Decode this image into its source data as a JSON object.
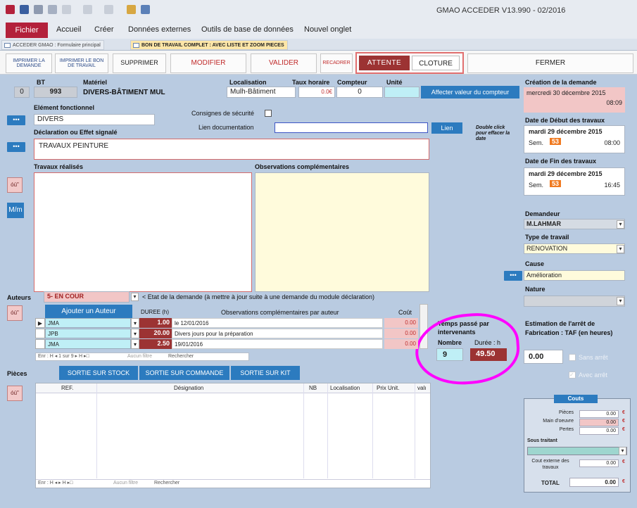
{
  "app": {
    "title": "GMAO ACCEDER V13.990 - 02/2016"
  },
  "ribbon": {
    "tabs": [
      "Fichier",
      "Accueil",
      "Créer",
      "Données externes",
      "Outils de base de données",
      "Nouvel onglet"
    ]
  },
  "doctabs": [
    "ACCEDER GMAO : Formulaire principal",
    "BON DE TRAVAIL COMPLET : AVEC LISTE  ET ZOOM PIECES"
  ],
  "toolbar": {
    "print_request": "IMPRIMER LA DEMANDE",
    "print_bt": "IMPRIMER LE BON DE TRAVAIL",
    "delete": "SUPPRIMER",
    "modify": "MODIFIER",
    "validate": "VALIDER",
    "recadrer": "RECADRER",
    "attente": "ATTENTE",
    "cloture": "CLOTURE",
    "close": "FERMER"
  },
  "header": {
    "labels": {
      "bt": "BT",
      "materiel": "Matériel",
      "localisation": "Localisation",
      "taux": "Taux horaire",
      "compteur": "Compteur",
      "unite": "Unité"
    },
    "zero": "0",
    "bt": "993",
    "materiel": "DIVERS-BÂTIMENT MUL",
    "localisation": "Mulh-Bâtiment",
    "taux": "0.0€",
    "compteur": "0",
    "affecter": "Affecter valeur du compteur"
  },
  "element": {
    "label": "Elément fonctionnel",
    "value": "DIVERS"
  },
  "consignes": {
    "label": "Consignes de sécurité"
  },
  "lien": {
    "label": "Lien documentation",
    "button": "Lien"
  },
  "declaration": {
    "label": "Déclaration ou Effet signalé",
    "value": "TRAVAUX PEINTURE"
  },
  "hint": "Double click pour effacer la date",
  "travaux": {
    "label": "Travaux réalisés"
  },
  "observations": {
    "label": "Observations complémentaires"
  },
  "sidebuttons": {
    "ou": "óù\"",
    "mm": "M/m"
  },
  "creation": {
    "label": "Création de la demande",
    "date": "mercredi 30 décembre 2015",
    "time": "08:09"
  },
  "debut": {
    "label": "Date de Début des travaux",
    "date": "mardi 29 décembre 2015",
    "sem_label": "Sem.",
    "sem": "53",
    "time": "08:00"
  },
  "fin": {
    "label": "Date de Fin des travaux",
    "date": "mardi 29 décembre 2015",
    "sem_label": "Sem.",
    "sem": "53",
    "time": "16:45"
  },
  "demandeur": {
    "label": "Demandeur",
    "value": "M.LAHMAR"
  },
  "type_travail": {
    "label": "Type de travail",
    "value": "RENOVATION"
  },
  "cause": {
    "label": "Cause",
    "value": "Amélioration"
  },
  "nature": {
    "label": "Nature",
    "value": ""
  },
  "estimation": {
    "label": "Estimation de l'arrêt de Fabrication : TAF (en heures)",
    "value": "0.00",
    "sans": "Sans arrêt",
    "avec": "Avec arrêt"
  },
  "auteurs": {
    "label": "Auteurs",
    "etat": "5- EN COUR",
    "etat_hint": "< Etat de la demande (à mettre à jour suite à une demande du module déclaration)",
    "add_button": "Ajouter un Auteur",
    "col_duree": "DUREE (h)",
    "col_obs": "Observations complémentaires par auteur",
    "col_cout": "Coût",
    "rows": [
      {
        "auteur": "JMA",
        "duree": "1.00",
        "obs": "le 12/01/2016",
        "cout": "0.00"
      },
      {
        "auteur": "JPB",
        "duree": "20.00",
        "obs": "Divers jours pour la préparation",
        "cout": "0.00"
      },
      {
        "auteur": "JMA",
        "duree": "2.50",
        "obs": "19/01/2016",
        "cout": "0.00"
      }
    ],
    "nav": "Enr : H  ◂  1 sur 9  ▸  H ▸□",
    "nav_filter": "Aucun filtre",
    "nav_search": "Rechercher"
  },
  "temps": {
    "title": "Temps passé par intervenants",
    "nombre_label": "Nombre",
    "nombre": "9",
    "duree_label": "Durée : h",
    "duree": "49.50"
  },
  "pieces": {
    "label": "Pièces",
    "stock": "SORTIE SUR STOCK",
    "commande": "SORTIE SUR COMMANDE",
    "kit": "SORTIE SUR KIT",
    "cols": [
      "REF.",
      "Désignation",
      "NB",
      "Localisation",
      "Prix Unit.",
      "valı"
    ],
    "nav": "Enr : H  ◂  ▸  H ▸□",
    "nav_filter": "Aucun filtre",
    "nav_search": "Rechercher"
  },
  "couts": {
    "title": "Couts",
    "pieces": "Pièces",
    "main": "Main d'oeuvre",
    "pertes": "Pertes",
    "sous_traitant": "Sous traitant",
    "cout_externe": "Cout externe des travaux",
    "total": "TOTAL",
    "v_pieces": "0.00",
    "v_main": "0.00",
    "v_pertes": "0.00",
    "v_externe": "0.00",
    "v_total": "0.00",
    "euro": "€"
  },
  "colors": {
    "accent": "#2c7bbf",
    "danger": "#9c3333",
    "highlight": "#ff00ff"
  }
}
